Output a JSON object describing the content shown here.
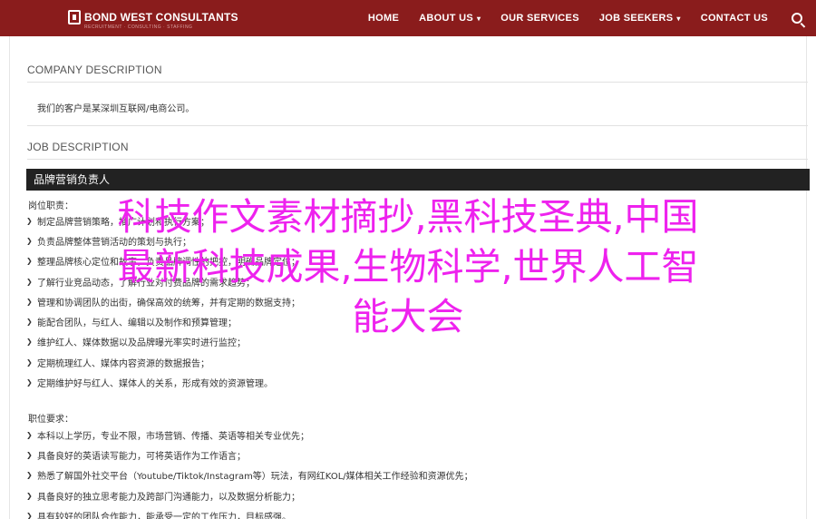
{
  "navbar": {
    "brand": "BOND WEST CONSULTANTS",
    "tagline": "RECRUITMENT · CONSULTING · STAFFING",
    "items": [
      {
        "label": "HOME",
        "dropdown": false
      },
      {
        "label": "ABOUT US",
        "dropdown": true
      },
      {
        "label": "OUR SERVICES",
        "dropdown": false
      },
      {
        "label": "JOB SEEKERS",
        "dropdown": true
      },
      {
        "label": "CONTACT US",
        "dropdown": false
      }
    ],
    "caret": "▾",
    "search_icon": "search-icon"
  },
  "company": {
    "heading": "COMPANY DESCRIPTION",
    "text": "我们的客户是某深圳互联网/电商公司。"
  },
  "job": {
    "heading": "JOB DESCRIPTION",
    "title": "品牌营销负责人",
    "responsibilities_heading": "岗位职责：",
    "responsibilities": [
      "制定品牌营销策略，推广计划和执行方案；",
      "负责品牌整体营销活动的策划与执行；",
      "整理品牌核心定位和故事，负责品牌调性的把控，明确品牌定位；",
      "了解行业竞品动态，了解行业对付费品牌的需求趋势；",
      "管理和协调团队的出街，确保高效的统筹，并有定期的数据支持；",
      "能配合团队，与红人、编辑以及制作和预算管理；",
      "维护红人、媒体数据以及品牌曝光率实时进行监控；",
      "定期梳理红人、媒体内容资源的数据报告；",
      "定期维护好与红人、媒体人的关系，形成有效的资源管理。"
    ],
    "requirements_heading": "职位要求：",
    "requirements": [
      "本科以上学历，专业不限，市场营销、传播、英语等相关专业优先；",
      "具备良好的英语读写能力，可将英语作为工作语言；",
      "熟悉了解国外社交平台（Youtube/Tiktok/Instagram等）玩法，有网红KOL/媒体相关工作经验和资源优先；",
      "具备良好的独立思考能力及跨部门沟通能力，以及数据分析能力；",
      "具有较好的团队合作能力，能承受一定的工作压力，目标感强。"
    ]
  },
  "overlay": {
    "line1": "科技作文素材摘抄,黑科技圣典,中国",
    "line2": "最新科技成果,生物科学,世界人工智",
    "line3": "能大会"
  },
  "chevron": "❯"
}
